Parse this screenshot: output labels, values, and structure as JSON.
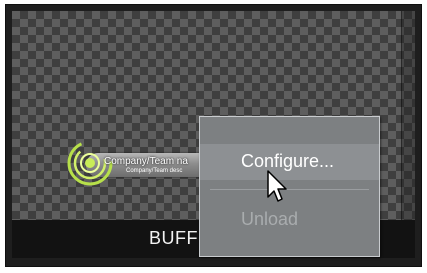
{
  "preview": {
    "lower_third": {
      "name": "Company/Team na",
      "description": "Company/Team desc",
      "accent_color": "#b7e04a"
    }
  },
  "label_bar": {
    "text": "BUFF"
  },
  "context_menu": {
    "items": [
      {
        "label": "Configure...",
        "state": "highlighted"
      },
      {
        "label": "Unload",
        "state": "disabled"
      }
    ]
  },
  "cursor": {
    "icon": "arrow-pointer-icon"
  }
}
